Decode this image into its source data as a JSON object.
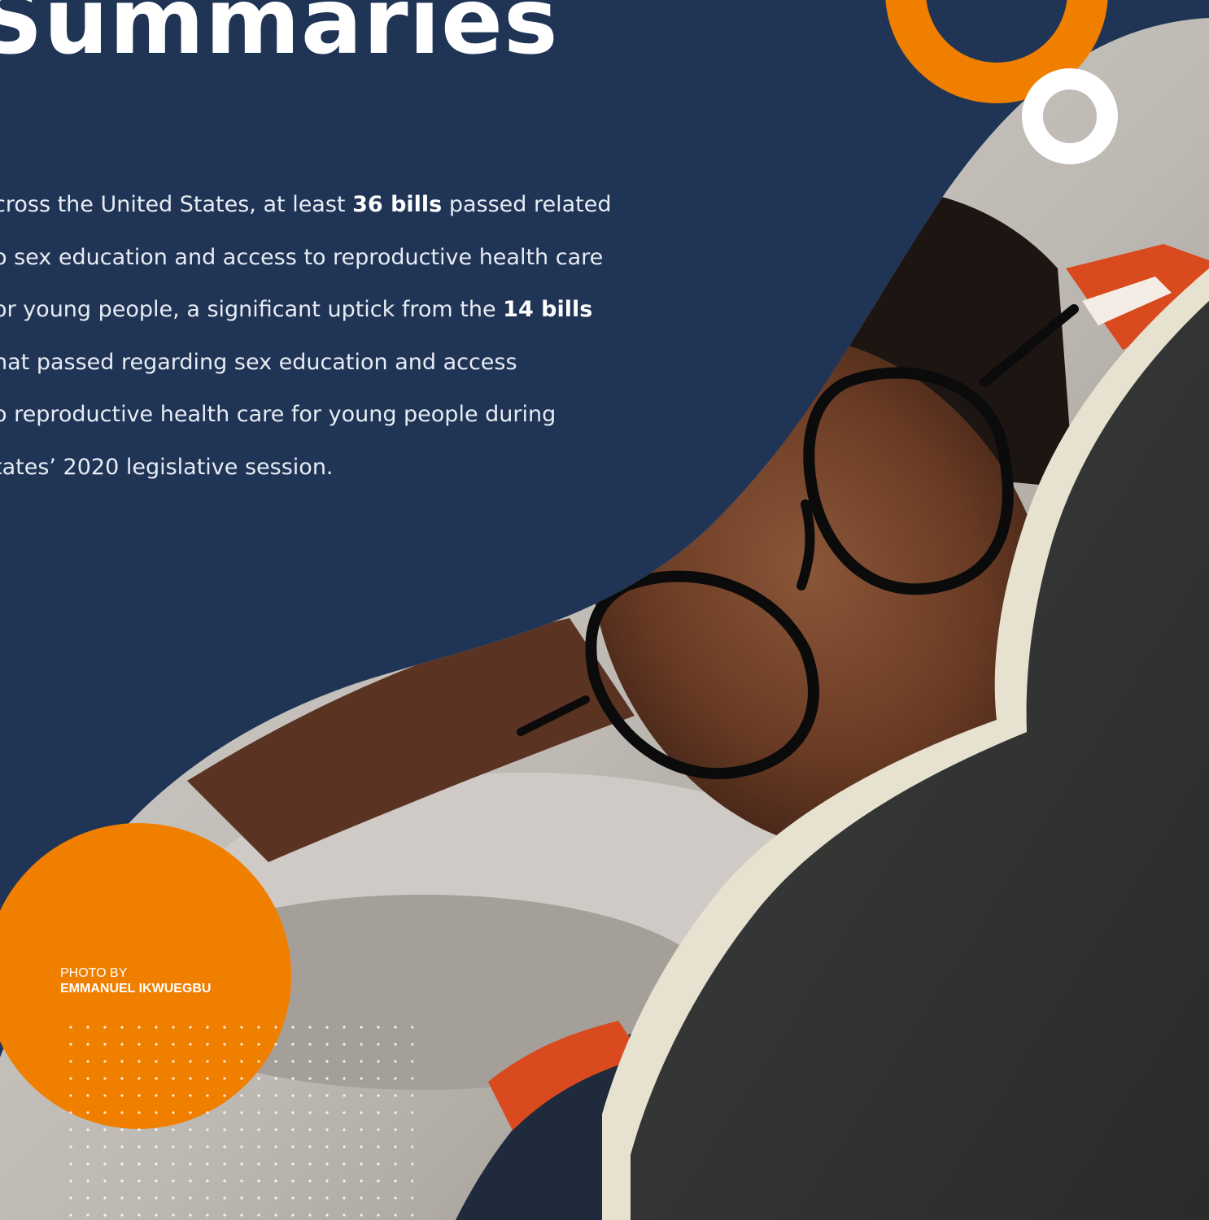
{
  "heading": {
    "title": "Summaries"
  },
  "summary": {
    "lines": [
      [
        "cross the United States, at least ",
        "36 bills",
        " passed related"
      ],
      [
        "o sex education and access to reproductive health care",
        "",
        ""
      ],
      [
        "or young people, a significant uptick from the ",
        "14 bills",
        ""
      ],
      [
        "hat passed regarding sex education and access",
        "",
        ""
      ],
      [
        "o reproductive health care for young people during",
        "",
        ""
      ],
      [
        "tates’ 2020 legislative session.",
        "",
        ""
      ]
    ]
  },
  "photo_credit": {
    "label": "PHOTO BY",
    "name": "EMMANUEL IKWUEGBU"
  },
  "colors": {
    "navy": "#203456",
    "orange": "#f07f00",
    "white": "#ffffff"
  }
}
